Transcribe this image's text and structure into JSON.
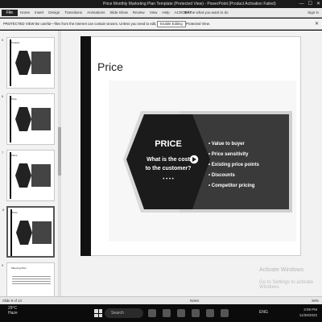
{
  "window": {
    "title": "Price Monthly Marketing Plan Template (Protected View) - PowerPoint (Product Activation Failed)",
    "controls": [
      "—",
      "☐",
      "✕"
    ]
  },
  "menu": {
    "file": "File",
    "tabs": [
      "Home",
      "Insert",
      "Design",
      "Transitions",
      "Animations",
      "Slide Show",
      "Review",
      "View",
      "Help",
      "ACROBAT"
    ],
    "tell_me": "Tell me what you want to do",
    "sign_in": "Sign in"
  },
  "protected_view": {
    "message": "PROTECTED VIEW  Be careful—files from the Internet can contain viruses. Unless you need to edit, it's safer to stay in Protected View.",
    "button": "Enable Editing"
  },
  "thumbnails": [
    {
      "number": "5",
      "title": "Product"
    },
    {
      "number": "6",
      "title": "Price"
    },
    {
      "number": "7",
      "title": "Place"
    },
    {
      "number": "8",
      "title": "Price"
    },
    {
      "number": "9",
      "title": "Planning Plan"
    }
  ],
  "slide": {
    "title": "Price",
    "heading": "PRICE",
    "question": "What is the cost to the customer?",
    "bullets": [
      "Value to buyer",
      "Price sensitivity",
      "Existing price points",
      "Discounts",
      "Competitor pricing"
    ]
  },
  "watermark": {
    "line1": "Activate Windows",
    "line2": "Go to Settings to activate Windows."
  },
  "status": {
    "slide_info": "Slide 8 of 13",
    "notes": "Notes",
    "zoom": "84%"
  },
  "taskbar": {
    "temp": "29°C",
    "weather": "Haze",
    "search": "Search",
    "lang": "ENG",
    "time": "3:09 PM",
    "date": "11/26/2022"
  },
  "colors": {
    "hex_fill": "#1b1b1b",
    "panel_fill": "#3a3a3a",
    "taskbar": "#0b0b0b"
  }
}
